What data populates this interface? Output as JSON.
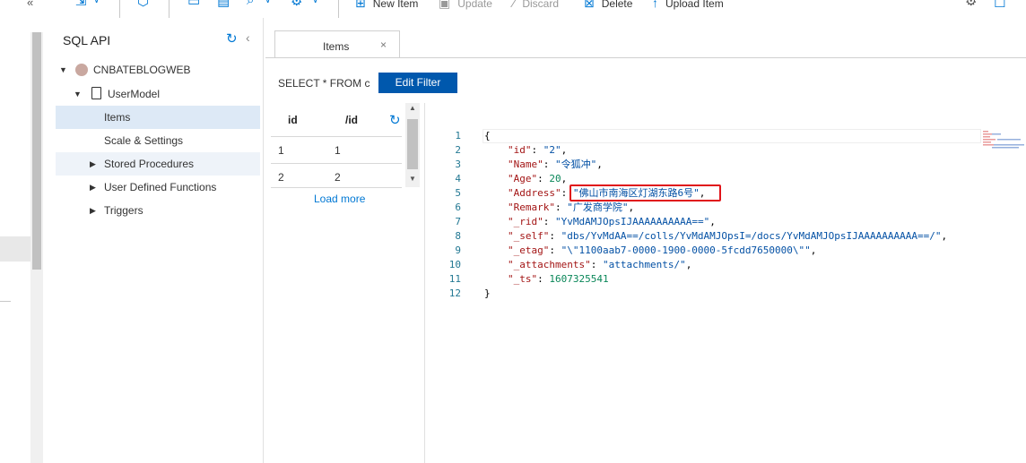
{
  "toolbar": {
    "new_item": "New Item",
    "update": "Update",
    "discard": "Discard",
    "delete": "Delete",
    "upload_item": "Upload Item",
    "collapse_glyph": "«"
  },
  "tree": {
    "title": "SQL API",
    "database": "CNBATEBLOGWEB",
    "container": "UserModel",
    "items": [
      "Items",
      "Scale & Settings",
      "Stored Procedures",
      "User Defined Functions",
      "Triggers"
    ]
  },
  "tab": {
    "label": "Items",
    "close": "×"
  },
  "query": {
    "text": "SELECT * FROM c",
    "edit_filter": "Edit Filter"
  },
  "doclist": {
    "col_id": "id",
    "col_pk": "/id",
    "rows": [
      {
        "id": "1",
        "pk": "1"
      },
      {
        "id": "2",
        "pk": "2"
      }
    ],
    "load_more": "Load more"
  },
  "editor": {
    "line_numbers": [
      "1",
      "2",
      "3",
      "4",
      "5",
      "6",
      "7",
      "8",
      "9",
      "10",
      "11",
      "12"
    ],
    "brace_open": "{",
    "brace_close": "}",
    "fields": [
      {
        "key": "\"id\"",
        "value": "\"2\"",
        "kind": "s"
      },
      {
        "key": "\"Name\"",
        "value": "\"令狐冲\"",
        "kind": "s"
      },
      {
        "key": "\"Age\"",
        "value": "20",
        "kind": "n"
      },
      {
        "key": "\"Address\"",
        "value": "\"佛山市南海区灯湖东路6号\"",
        "kind": "s"
      },
      {
        "key": "\"Remark\"",
        "value": "\"广发商学院\"",
        "kind": "s"
      },
      {
        "key": "\"_rid\"",
        "value": "\"YvMdAMJOpsIJAAAAAAAAAA==\"",
        "kind": "s"
      },
      {
        "key": "\"_self\"",
        "value": "\"dbs/YvMdAA==/colls/YvMdAMJOpsI=/docs/YvMdAMJOpsIJAAAAAAAAAA==/\"",
        "kind": "s"
      },
      {
        "key": "\"_etag\"",
        "value": "\"\\\"1100aab7-0000-1900-0000-5fcdd7650000\\\"\"",
        "kind": "s"
      },
      {
        "key": "\"_attachments\"",
        "value": "\"attachments/\"",
        "kind": "s"
      },
      {
        "key": "\"_ts\"",
        "value": "1607325541",
        "kind": "n"
      }
    ]
  },
  "colors": {
    "accent": "#0078d4",
    "button": "#0058ad",
    "highlight_box": "#e0141a",
    "selected_row": "#dde9f6"
  }
}
